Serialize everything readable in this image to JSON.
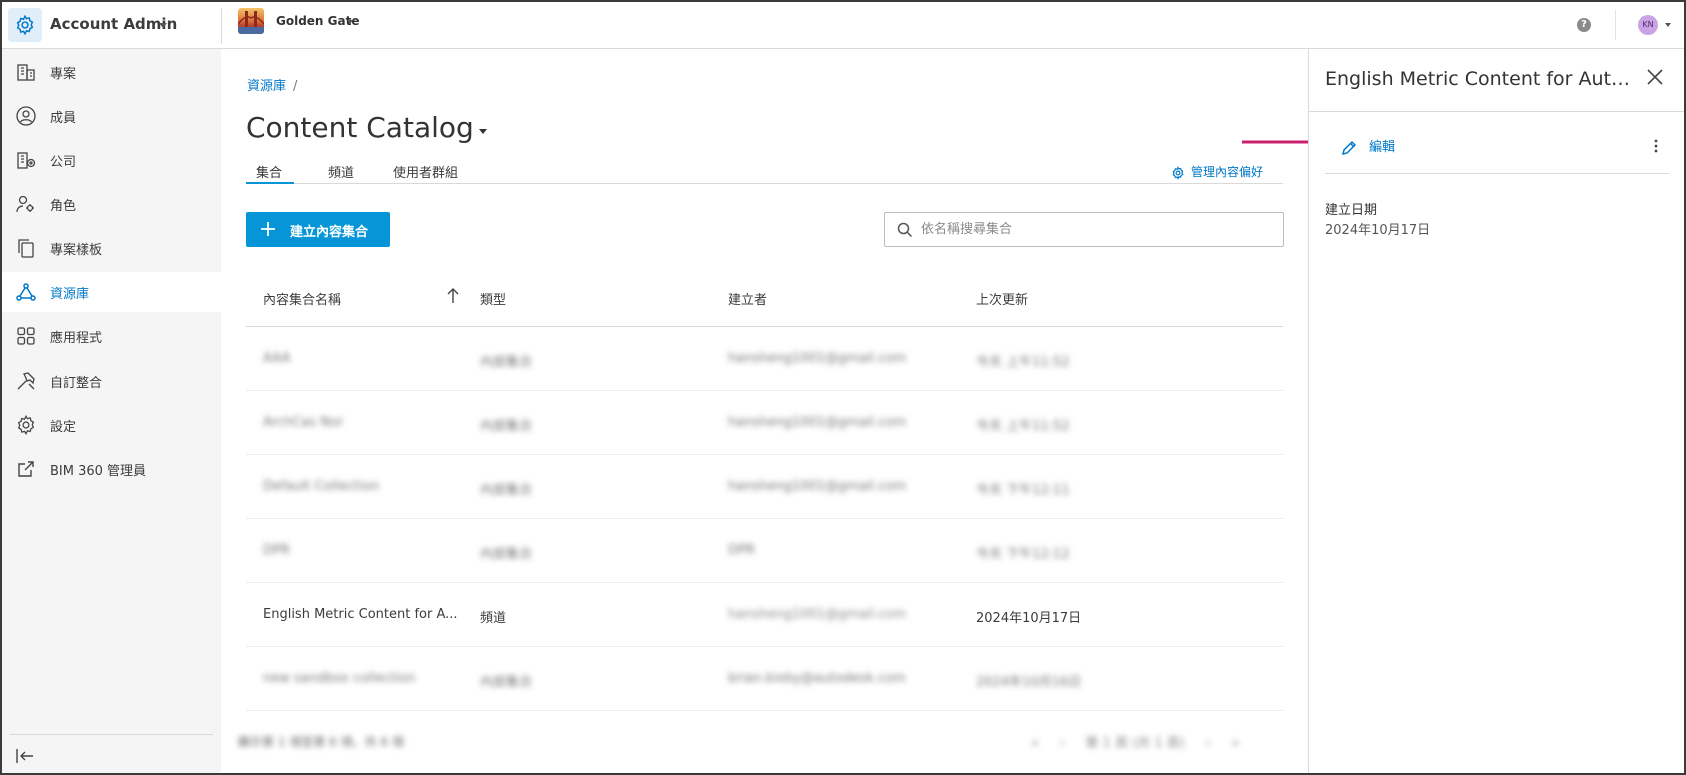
{
  "header": {
    "app_title": "Account Admin",
    "project_name": "Golden Gate",
    "help_icon": "?",
    "avatar_initials": "KN"
  },
  "sidebar": {
    "items": [
      {
        "label": "專案",
        "icon": "building-icon"
      },
      {
        "label": "成員",
        "icon": "person-icon"
      },
      {
        "label": "公司",
        "icon": "company-icon"
      },
      {
        "label": "角色",
        "icon": "role-icon"
      },
      {
        "label": "專案樣板",
        "icon": "template-icon"
      },
      {
        "label": "資源庫",
        "icon": "library-icon",
        "active": true
      },
      {
        "label": "應用程式",
        "icon": "apps-icon"
      },
      {
        "label": "自訂整合",
        "icon": "integration-icon"
      },
      {
        "label": "設定",
        "icon": "gear-icon"
      },
      {
        "label": "BIM 360 管理員",
        "icon": "external-link-icon"
      }
    ]
  },
  "main": {
    "breadcrumb": {
      "root": "資源庫",
      "separator": "/"
    },
    "page_title": "Content Catalog",
    "tabs": [
      {
        "label": "集合",
        "active": true
      },
      {
        "label": "頻道"
      },
      {
        "label": "使用者群組"
      }
    ],
    "manage_preferences": "管理內容偏好",
    "create_button": "建立內容集合",
    "search_placeholder": "依名稱搜尋集合",
    "table": {
      "headers": [
        "內容集合名稱",
        "類型",
        "建立者",
        "上次更新"
      ],
      "rows": [
        {
          "name": "AAA",
          "type": "內部集合",
          "creator": "hansheng1001@gmail.com",
          "updated": "今天 上午11:52",
          "blurred": true
        },
        {
          "name": "ArchCas Nor",
          "type": "內部集合",
          "creator": "hansheng1001@gmail.com",
          "updated": "今天 上午11:52",
          "blurred": true
        },
        {
          "name": "Default Collection",
          "type": "內部集合",
          "creator": "hansheng1001@gmail.com",
          "updated": "今天 下午12:11",
          "blurred": true
        },
        {
          "name": "DPR",
          "type": "內部集合",
          "creator": "DPR",
          "updated": "今天 下午12:12",
          "blurred": true
        },
        {
          "name": "English Metric Content for A...",
          "type": "頻道",
          "creator": "hansheng1001@gmail.com",
          "updated": "2024年10月17日",
          "blurred": false
        },
        {
          "name": "new sandbox collection",
          "type": "內部集合",
          "creator": "brian.bixby@autodesk.com",
          "updated": "2024年10月16日",
          "blurred": true
        }
      ]
    },
    "footer_text": "顯示第 1 項至第 6 項，共 6 項",
    "pager_text": "第 1 頁 (共 1 頁)"
  },
  "panel": {
    "title": "English Metric Content for Auto...",
    "edit_label": "編輯",
    "created_label": "建立日期",
    "created_value": "2024年10月17日"
  },
  "colors": {
    "accent": "#0696d7",
    "link": "#0077c8",
    "annotation_arrow": "#c8206f"
  }
}
